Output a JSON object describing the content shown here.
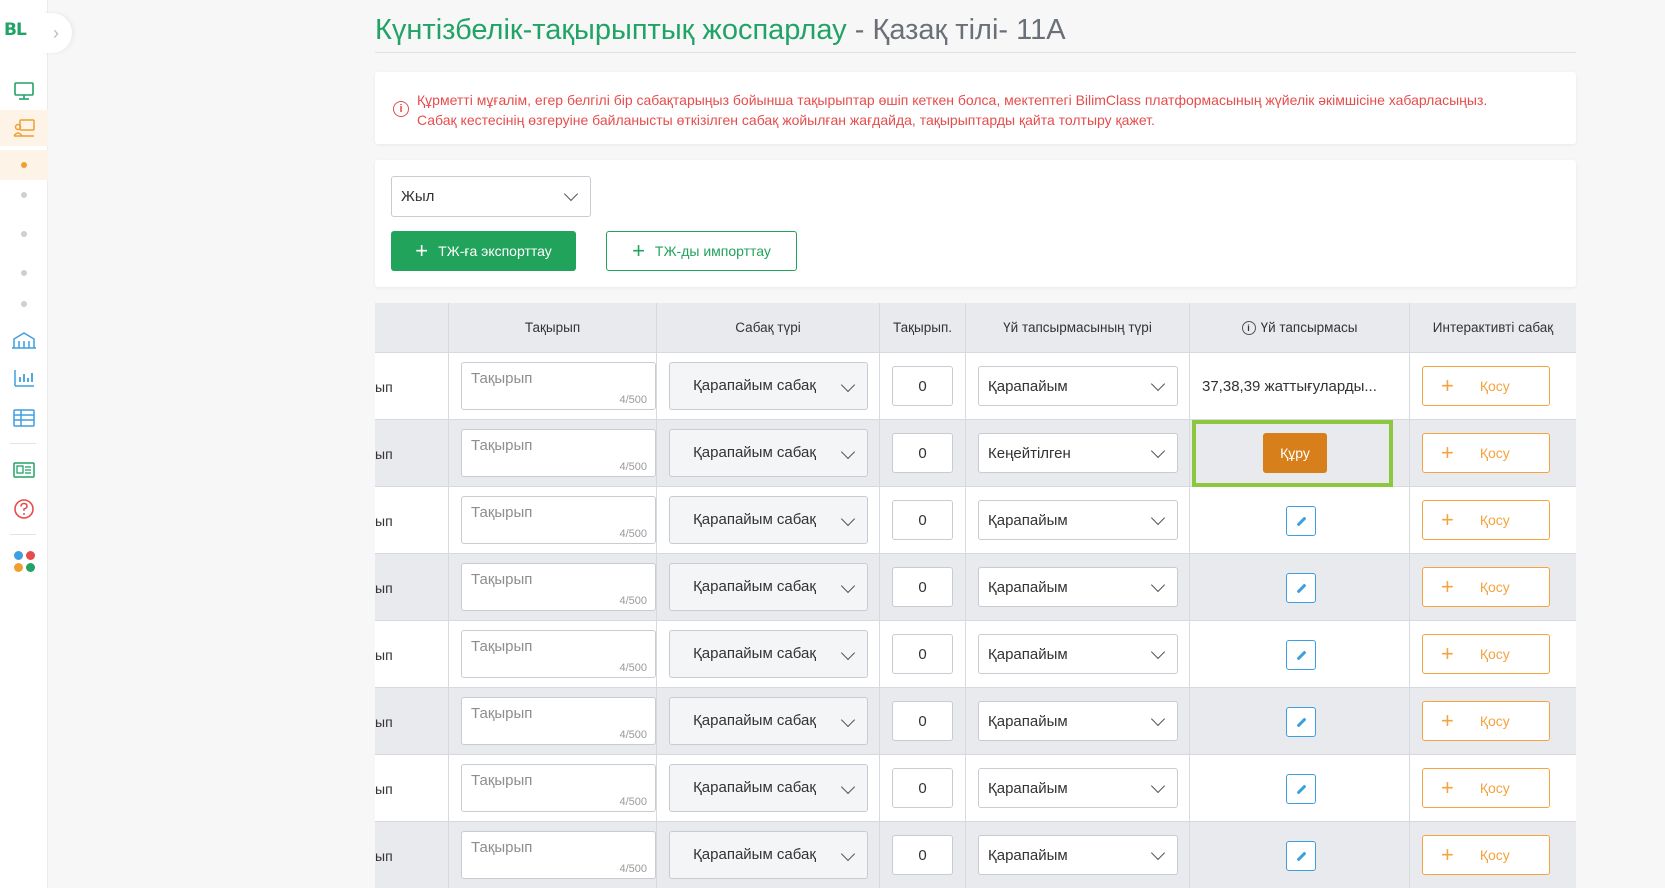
{
  "sidebar": {
    "logo": "BL",
    "toggle": "›"
  },
  "page": {
    "title_main": "Күнтізбелік-тақырыптық жоспарлау",
    "title_separator": " - ",
    "title_sub": "Қазақ тілі- 11А"
  },
  "notice": {
    "icon": "info-icon",
    "text": "Құрметті мұғалім, егер белгілі бір сабақтарыңыз бойынша тақырыптар өшіп кеткен болса, мектептегі BilimClass платформасының жүйелік әкімшісіне хабарласыңыз. Сабақ кестесінің өзгеруіне байланысты өткізілген сабақ жойылған жағдайда, тақырыптарды қайта толтыру қажет."
  },
  "filters": {
    "year_select": "Жыл",
    "export_button": "ТЖ-ға экспорттау",
    "import_button": "ТЖ-ды импорттау"
  },
  "table": {
    "headers": {
      "topic": "Тақырып",
      "lesson_type": "Сабақ түрі",
      "topic_num": "Тақырып.",
      "hw_type": "Үй тапсырмасының түрі",
      "homework": "Үй тапсырмасы",
      "interactive": "Интерактивті сабақ"
    },
    "rows": [
      {
        "first": "ып",
        "topic_placeholder": "Тақырып",
        "counter": "4/500",
        "lesson_type": "Қарапайым сабақ",
        "num": "0",
        "hw_type": "Қарапайым",
        "homework_text": "37,38,39 жаттығуларды...",
        "add": "Қосу"
      },
      {
        "first": "ып",
        "topic_placeholder": "Тақырып",
        "counter": "4/500",
        "lesson_type": "Қарапайым сабақ",
        "num": "0",
        "hw_type": "Кеңейтілген",
        "build": "Құру",
        "add": "Қосу"
      },
      {
        "first": "ып",
        "topic_placeholder": "Тақырып",
        "counter": "4/500",
        "lesson_type": "Қарапайым сабақ",
        "num": "0",
        "hw_type": "Қарапайым",
        "add": "Қосу"
      },
      {
        "first": "ып",
        "topic_placeholder": "Тақырып",
        "counter": "4/500",
        "lesson_type": "Қарапайым сабақ",
        "num": "0",
        "hw_type": "Қарапайым",
        "add": "Қосу"
      },
      {
        "first": "ып",
        "topic_placeholder": "Тақырып",
        "counter": "4/500",
        "lesson_type": "Қарапайым сабақ",
        "num": "0",
        "hw_type": "Қарапайым",
        "add": "Қосу"
      },
      {
        "first": "ып",
        "topic_placeholder": "Тақырып",
        "counter": "4/500",
        "lesson_type": "Қарапайым сабақ",
        "num": "0",
        "hw_type": "Қарапайым",
        "add": "Қосу"
      },
      {
        "first": "ып",
        "topic_placeholder": "Тақырып",
        "counter": "4/500",
        "lesson_type": "Қарапайым сабақ",
        "num": "0",
        "hw_type": "Қарапайым",
        "add": "Қосу"
      },
      {
        "first": "ып",
        "topic_placeholder": "Тақырып",
        "counter": "4/500",
        "lesson_type": "Қарапайым сабақ",
        "num": "0",
        "hw_type": "Қарапайым",
        "add": "Қосу"
      }
    ]
  },
  "colors": {
    "brand_green": "#21a366",
    "warning_red": "#e74c4c",
    "accent_orange": "#f4a340",
    "build_orange": "#d77f1a",
    "highlight_green": "#8dc63f",
    "edit_blue": "#3d9fe0"
  }
}
